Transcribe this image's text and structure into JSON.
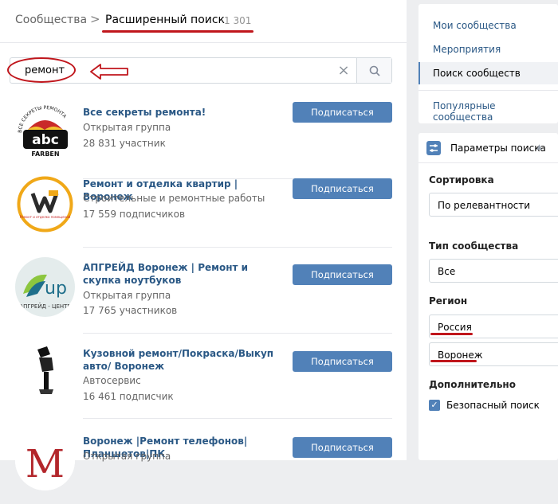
{
  "header": {
    "breadcrumb": "Сообщества",
    "separator": ">",
    "current": "Расширенный поиск",
    "count": "1 301"
  },
  "search": {
    "value": "ремонт",
    "clear_icon": "close-icon",
    "search_icon": "search-icon"
  },
  "groups": [
    {
      "title": "Все секреты ремонта!",
      "type": "Открытая группа",
      "members": "28 831 участник",
      "button": "Подписаться"
    },
    {
      "title": "Ремонт и отделка квартир | Воронеж",
      "type": "Строительные и ремонтные работы",
      "members": "17 559 подписчиков",
      "button": "Подписаться"
    },
    {
      "title": "АПГРЕЙД Воронеж | Ремонт и скупка ноутбуков",
      "type": "Открытая группа",
      "members": "17 765 участников",
      "button": "Подписаться"
    },
    {
      "title": "Кузовной ремонт/Покраска/Выкуп авто/ Воронеж",
      "type": "Автосервис",
      "members": "16 461 подписчик",
      "button": "Подписаться"
    },
    {
      "title": "Воронеж |Ремонт телефонов|Планшетов|ПК",
      "type": "Открытая группа",
      "members": "",
      "button": "Подписаться"
    }
  ],
  "avatars": [
    {
      "text_main": "abc",
      "text_sub": "FARBEN",
      "text_arc": "ВСЕ СЕКРЕТЫ РЕМОНТА"
    },
    {
      "text_main": "Ремонт и отделка помещений"
    },
    {
      "text_main": "up",
      "text_sub": "АПГРЕЙД - ЦЕНТР"
    },
    {
      "text_main": ""
    },
    {
      "text_main": "M"
    }
  ],
  "sidebar": {
    "items": [
      {
        "label": "Мои сообщества"
      },
      {
        "label": "Мероприятия"
      },
      {
        "label": "Поиск сообществ"
      },
      {
        "label": "Популярные сообщества"
      }
    ]
  },
  "params": {
    "title": "Параметры поиска",
    "sort_label": "Сортировка",
    "sort_value": "По релевантности",
    "type_label": "Тип сообщества",
    "type_value": "Все",
    "region_label": "Регион",
    "country_value": "Россия",
    "city_value": "Воронеж",
    "extra_label": "Дополнительно",
    "safe_label": "Безопасный поиск",
    "safe_checked": true
  },
  "colors": {
    "accent": "#5181b8",
    "link": "#2a5885",
    "annotation": "#c0161c"
  }
}
